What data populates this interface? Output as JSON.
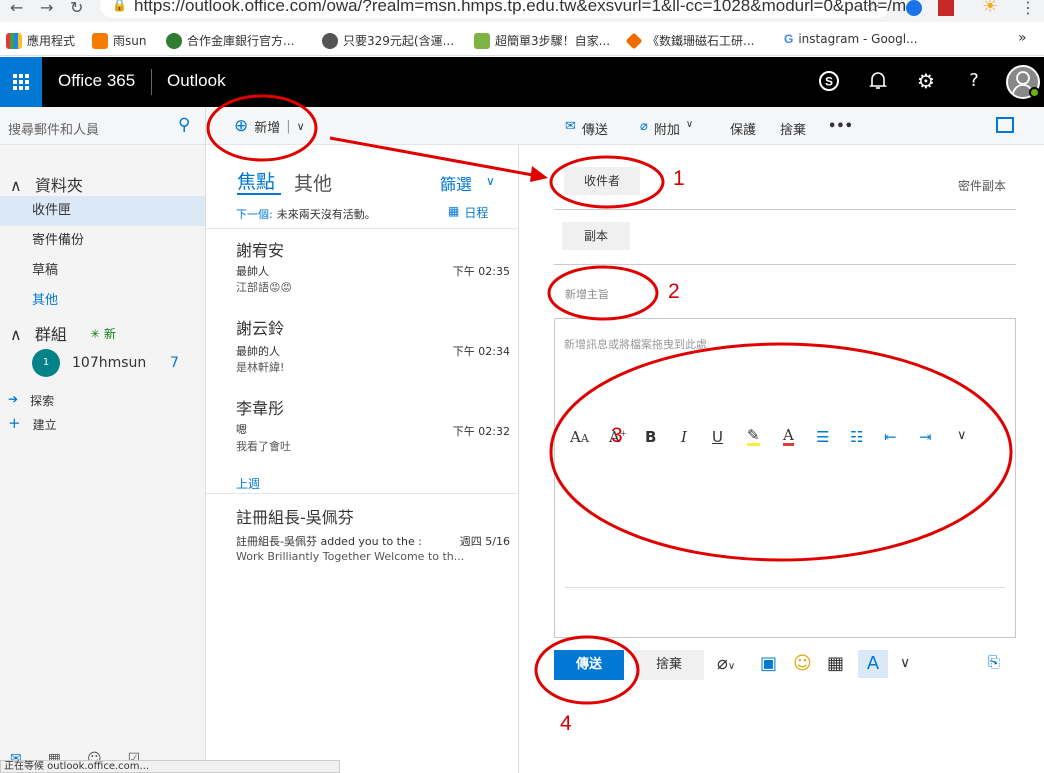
{
  "browser": {
    "url": "https://outlook.office.com/owa/?realm=msn.hmps.tp.edu.tw&exsvurl=1&ll-cc=1028&modurl=0&path=/m...",
    "bookmarks": [
      "應用程式",
      "雨sun",
      "合作金庫銀行官方...",
      "只要329元起(含運...",
      "超簡單3步驟！自家...",
      "《数鐵珊磁石工研...",
      "instagram - Googl..."
    ],
    "more": "»",
    "status_text": "正在等候 outlook.office.com..."
  },
  "header": {
    "brand": "Office 365",
    "app": "Outlook"
  },
  "cmdbar": {
    "search_placeholder": "搜尋郵件和人員",
    "new_label": "新增",
    "send": "傳送",
    "attach": "附加",
    "protect": "保護",
    "discard": "捨棄",
    "more": "•••"
  },
  "nav": {
    "folders_header": "資料夾",
    "items": [
      "收件匣",
      "寄件備份",
      "草稿",
      "其他"
    ],
    "groups_header": "群組",
    "new_group": "新",
    "group_name": "107hmsun",
    "group_avatar": "1",
    "group_count": "7",
    "explore": "探索",
    "create": "建立"
  },
  "list": {
    "tab_focused": "焦點",
    "tab_other": "其他",
    "filter": "篩選",
    "next_label": "下一個:",
    "next_text": "未來兩天沒有活動。",
    "calendar": "日程",
    "section_lastweek": "上週",
    "messages": [
      {
        "sender": "謝宥安",
        "subject": "最帥人",
        "time": "下午 02:35",
        "preview": "江部語😡😡"
      },
      {
        "sender": "謝云鈴",
        "subject": "最帥的人",
        "time": "下午 02:34",
        "preview": "是林軒緯!"
      },
      {
        "sender": "李韋彤",
        "subject": "嗯",
        "time": "下午 02:32",
        "preview": "我看了會吐"
      },
      {
        "sender": "註冊組長-吳佩芬",
        "subject": "註冊組長-吳佩芬 added you to the :",
        "time": "週四 5/16",
        "preview": "Work Brilliantly Together  Welcome to th..."
      }
    ]
  },
  "compose": {
    "to_label": "收件者",
    "bcc_label": "密件副本",
    "cc_label": "副本",
    "subject_placeholder": "新增主旨",
    "body_placeholder": "新增訊息或將檔案拖曳到此處",
    "send": "傳送",
    "discard": "捨棄"
  },
  "annotations": [
    "1",
    "2",
    "3",
    "4"
  ],
  "colors": {
    "accent": "#0078d4",
    "annotation": "#d40000"
  }
}
